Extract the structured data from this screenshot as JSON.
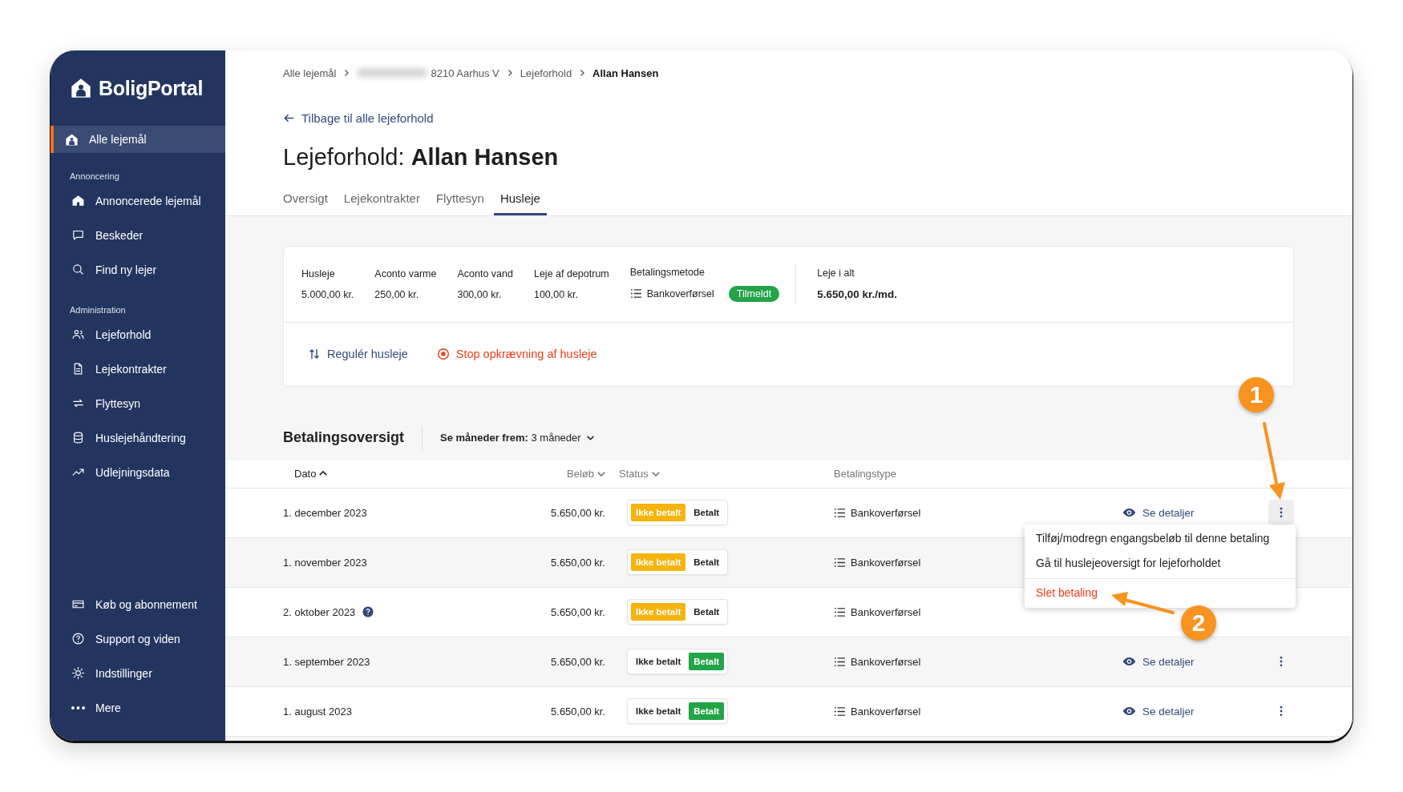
{
  "sidebar": {
    "logo": "BoligPortal",
    "top_item": {
      "label": "Alle lejemål",
      "selected": true
    },
    "sections": [
      {
        "label": "Annoncering",
        "items": [
          {
            "label": "Annoncerede lejemål",
            "selected": false
          },
          {
            "label": "Beskeder",
            "selected": false
          },
          {
            "label": "Find ny lejer",
            "selected": false
          }
        ]
      },
      {
        "label": "Administration",
        "items": [
          {
            "label": "Lejeforhold",
            "selected": false
          },
          {
            "label": "Lejekontrakter",
            "selected": false
          },
          {
            "label": "Flyttesyn",
            "selected": false
          },
          {
            "label": "Huslejehåndtering",
            "selected": false
          },
          {
            "label": "Udlejningsdata",
            "selected": false
          }
        ]
      }
    ],
    "bottom_items": [
      {
        "label": "Køb og abonnement",
        "selected": false
      },
      {
        "label": "Support og viden",
        "selected": false
      },
      {
        "label": "Indstillinger",
        "selected": false
      },
      {
        "label": "Mere",
        "selected": false
      }
    ]
  },
  "breadcrumb": [
    {
      "label": "Alle lejemål",
      "current": false,
      "redacted_prefix": false
    },
    {
      "label": "8210 Aarhus V",
      "current": false,
      "redacted_prefix": true
    },
    {
      "label": "Lejeforhold",
      "current": false,
      "redacted_prefix": false
    },
    {
      "label": "Allan Hansen",
      "current": true,
      "redacted_prefix": false
    }
  ],
  "back_link": "Tilbage til alle lejeforhold",
  "title": {
    "prefix": "Lejeforhold:",
    "name": "Allan Hansen"
  },
  "tabs": [
    {
      "label": "Oversigt",
      "selected": false
    },
    {
      "label": "Lejekontrakter",
      "selected": false
    },
    {
      "label": "Flyttesyn",
      "selected": false
    },
    {
      "label": "Husleje",
      "selected": true
    }
  ],
  "rent_card": {
    "fields": [
      {
        "label": "Husleje",
        "value": "5.000,00 kr."
      },
      {
        "label": "Aconto varme",
        "value": "250,00 kr."
      },
      {
        "label": "Aconto vand",
        "value": "300,00 kr."
      },
      {
        "label": "Leje af depotrum",
        "value": "100,00 kr."
      }
    ],
    "payment_method": {
      "label": "Betalingsmetode",
      "value": "Bankoverførsel",
      "badge": "Tilmeldt"
    },
    "total": {
      "label": "Leje i alt",
      "value": "5.650,00 kr./md."
    },
    "actions": [
      {
        "label": "Regulér husleje",
        "kind": "adjust"
      },
      {
        "label": "Stop opkrævning af husleje",
        "kind": "stop"
      }
    ]
  },
  "payments": {
    "title": "Betalingsoversigt",
    "filter_label": "Se måneder frem:",
    "filter_value": "3 måneder",
    "columns": [
      {
        "label": "Dato",
        "sortable": true,
        "sorted": true
      },
      {
        "label": "Beløb",
        "sortable": true,
        "sorted": false
      },
      {
        "label": "Status",
        "sortable": true,
        "sorted": false
      },
      {
        "label": "Betalingstype",
        "sortable": false,
        "sorted": false
      }
    ],
    "rows": [
      {
        "date": "1. december 2023",
        "help": false,
        "amount": "5.650,00 kr.",
        "status": [
          {
            "label": "Ikke betalt",
            "selected": true
          },
          {
            "label": "Betalt",
            "selected": false
          }
        ],
        "type": "Bankoverførsel",
        "details": "Se detaljer",
        "menu_open": true
      },
      {
        "date": "1. november 2023",
        "help": false,
        "amount": "5.650,00 kr.",
        "status": [
          {
            "label": "Ikke betalt",
            "selected": true
          },
          {
            "label": "Betalt",
            "selected": false
          }
        ],
        "type": "Bankoverførsel"
      },
      {
        "date": "2. oktober 2023",
        "help": true,
        "amount": "5.650,00 kr.",
        "status": [
          {
            "label": "Ikke betalt",
            "selected": true
          },
          {
            "label": "Betalt",
            "selected": false
          }
        ],
        "type": "Bankoverførsel"
      },
      {
        "date": "1. september 2023",
        "help": false,
        "amount": "5.650,00 kr.",
        "status": [
          {
            "label": "Ikke betalt",
            "selected": false
          },
          {
            "label": "Betalt",
            "selected": true
          }
        ],
        "type": "Bankoverførsel",
        "details": "Se detaljer",
        "menu_open": false
      },
      {
        "date": "1. august 2023",
        "help": false,
        "amount": "5.650,00 kr.",
        "status": [
          {
            "label": "Ikke betalt",
            "selected": false
          },
          {
            "label": "Betalt",
            "selected": true
          }
        ],
        "type": "Bankoverførsel",
        "details": "Se detaljer",
        "menu_open": false
      }
    ]
  },
  "context_menu": [
    {
      "label": "Tilføj/modregn engangsbeløb til denne betaling",
      "kind": "normal"
    },
    {
      "label": "Gå til huslejeoversigt for lejeforholdet",
      "kind": "normal"
    },
    {
      "label": "Slet betaling",
      "kind": "danger"
    }
  ],
  "annotations": [
    {
      "label": "1"
    },
    {
      "label": "2"
    }
  ]
}
